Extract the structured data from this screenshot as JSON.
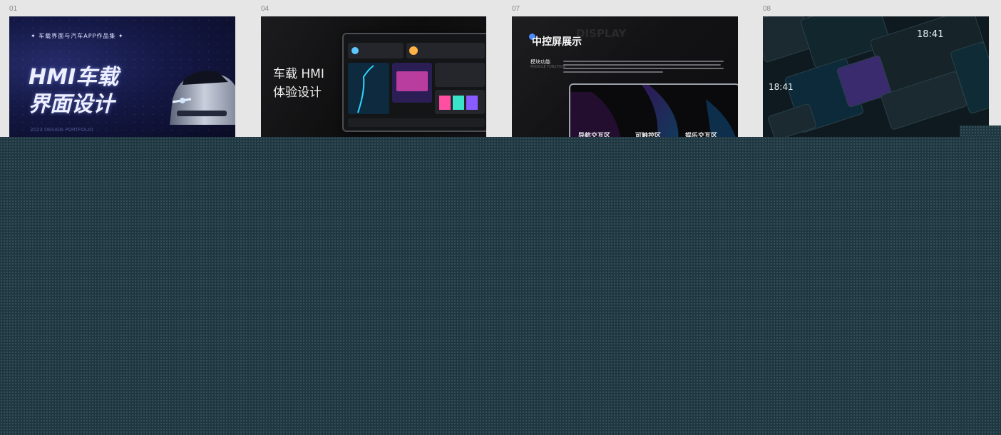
{
  "frames": [
    {
      "number": "01",
      "subtitle": "车载界面与汽车APP作品集",
      "title_line1": "HMI车载",
      "title_line2": "界面设计",
      "footer": "2023 DESIGN PORTFOLIO"
    },
    {
      "number": "04",
      "title_line1": "车载 HMI",
      "title_line2": "体验设计"
    },
    {
      "number": "07",
      "watermark": "DISPLAY",
      "heading": "中控屏展示",
      "section_label": "模块功能",
      "section_sublabel": "MODULE FUNCTION",
      "zones": [
        "导航交互区",
        "可触控区",
        "娱乐交互区"
      ]
    },
    {
      "number": "08",
      "clock_a": "18:41",
      "clock_b": "18:41"
    }
  ],
  "colors": {
    "canvas_bg": "#1f3740",
    "strip_bg": "#e6e6e6",
    "accent_blue": "#4d8bff"
  }
}
